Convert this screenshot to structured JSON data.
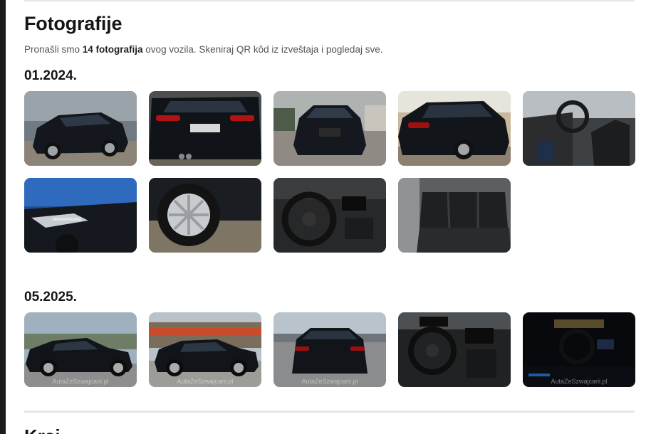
{
  "section": {
    "title": "Fotografije",
    "intro_prefix": "Pronašli smo ",
    "intro_count": "14 fotografija",
    "intro_suffix": " ovog vozila. Skeniraj QR kôd iz izveštaja i pogledaj sve."
  },
  "groups": [
    {
      "date": "01.2024.",
      "photos": [
        {
          "icon": "car-front-threequarter-photo"
        },
        {
          "icon": "car-rear-photo"
        },
        {
          "icon": "car-front-photo"
        },
        {
          "icon": "car-rear-threequarter-photo"
        },
        {
          "icon": "interior-front-seats-photo"
        },
        {
          "icon": "fender-vent-photo"
        },
        {
          "icon": "wheel-photo"
        },
        {
          "icon": "steering-wheel-photo"
        },
        {
          "icon": "rear-seats-photo"
        }
      ]
    },
    {
      "date": "05.2025.",
      "photos": [
        {
          "icon": "car-side-photo",
          "watermark": "AutaZeSzwajcarii.pl"
        },
        {
          "icon": "car-side-street-photo",
          "watermark": "AutaZeSzwajcarii.pl"
        },
        {
          "icon": "car-rear-parking-photo",
          "watermark": "AutaZeSzwajcarii.pl"
        },
        {
          "icon": "dashboard-photo"
        },
        {
          "icon": "interior-night-photo",
          "watermark": "AutaZeSzwajcarii.pl"
        }
      ]
    }
  ],
  "next_section": {
    "title": "Kraj"
  },
  "colors": {
    "car_body": "#14171d",
    "text_dark": "#161616",
    "text_muted": "#555555",
    "divider": "#e6e6e6"
  }
}
